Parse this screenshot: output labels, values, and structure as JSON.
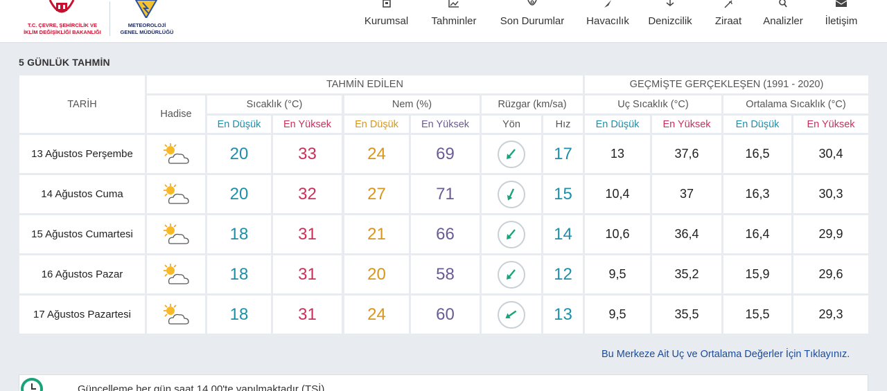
{
  "header": {
    "ministry_line1": "T.C. ÇEVRE, ŞEHİRCİLİK VE",
    "ministry_line2": "İKLİM DEĞİŞİKLİĞİ BAKANLIĞI",
    "mgm_line1": "METEOROLOJİ",
    "mgm_line2": "GENEL MÜDÜRLÜĞÜ",
    "nav": [
      {
        "label": "Kurumsal",
        "icon": "building-icon"
      },
      {
        "label": "Tahminler",
        "icon": "chart-icon"
      },
      {
        "label": "Son Durumlar",
        "icon": "location-icon"
      },
      {
        "label": "Havacılık",
        "icon": "plane-icon"
      },
      {
        "label": "Denizcilik",
        "icon": "ship-icon"
      },
      {
        "label": "Ziraat",
        "icon": "plant-icon"
      },
      {
        "label": "Analizler",
        "icon": "magnifier-icon"
      },
      {
        "label": "İletişim",
        "icon": "mail-icon"
      }
    ]
  },
  "forecast": {
    "title": "5 GÜNLÜK TAHMİN",
    "headers": {
      "date": "TARİH",
      "predicted": "TAHMİN EDİLEN",
      "historical": "GEÇMİŞTE GERÇEKLEŞEN (1991 - 2020)",
      "event": "Hadise",
      "temperature": "Sıcaklık (°C)",
      "humidity": "Nem (%)",
      "wind": "Rüzgar (km/sa)",
      "extreme_temp": "Uç Sıcaklık (°C)",
      "avg_temp": "Ortalama Sıcaklık (°C)",
      "low": "En Düşük",
      "high": "En Yüksek",
      "direction": "Yön",
      "speed": "Hız"
    },
    "rows": [
      {
        "date": "13 Ağustos Perşembe",
        "icon": "partly-cloudy-icon",
        "t_low": "20",
        "t_high": "33",
        "h_low": "24",
        "h_high": "69",
        "wind_deg": 225,
        "wind_speed": "17",
        "x_low": "13",
        "x_high": "37,6",
        "a_low": "16,5",
        "a_high": "30,4"
      },
      {
        "date": "14 Ağustos Cuma",
        "icon": "partly-cloudy-icon",
        "t_low": "20",
        "t_high": "32",
        "h_low": "27",
        "h_high": "71",
        "wind_deg": 210,
        "wind_speed": "15",
        "x_low": "10,4",
        "x_high": "37",
        "a_low": "16,3",
        "a_high": "30,3"
      },
      {
        "date": "15 Ağustos Cumartesi",
        "icon": "partly-cloudy-icon",
        "t_low": "18",
        "t_high": "31",
        "h_low": "21",
        "h_high": "66",
        "wind_deg": 225,
        "wind_speed": "14",
        "x_low": "10,6",
        "x_high": "36,4",
        "a_low": "16,4",
        "a_high": "29,9"
      },
      {
        "date": "16 Ağustos Pazar",
        "icon": "partly-cloudy-icon",
        "t_low": "18",
        "t_high": "31",
        "h_low": "20",
        "h_high": "58",
        "wind_deg": 225,
        "wind_speed": "12",
        "x_low": "9,5",
        "x_high": "35,2",
        "a_low": "15,9",
        "a_high": "29,6"
      },
      {
        "date": "17 Ağustos Pazartesi",
        "icon": "partly-cloudy-icon",
        "t_low": "18",
        "t_high": "31",
        "h_low": "24",
        "h_high": "60",
        "wind_deg": 240,
        "wind_speed": "13",
        "x_low": "9,5",
        "x_high": "35,5",
        "a_low": "15,5",
        "a_high": "29,3"
      }
    ],
    "link": "Bu Merkeze Ait Uç ve Ortalama Değerler İçin Tıklayınız."
  },
  "update_note": "Güncelleme her gün saat 14.00'te yapılmaktadır (TSİ).",
  "colors": {
    "low_temp": "#1e8fa8",
    "high_temp": "#c8315a",
    "humidity_low": "#d9961a",
    "humidity_high": "#6b5b95",
    "wind_arrow": "#1aa37a"
  }
}
